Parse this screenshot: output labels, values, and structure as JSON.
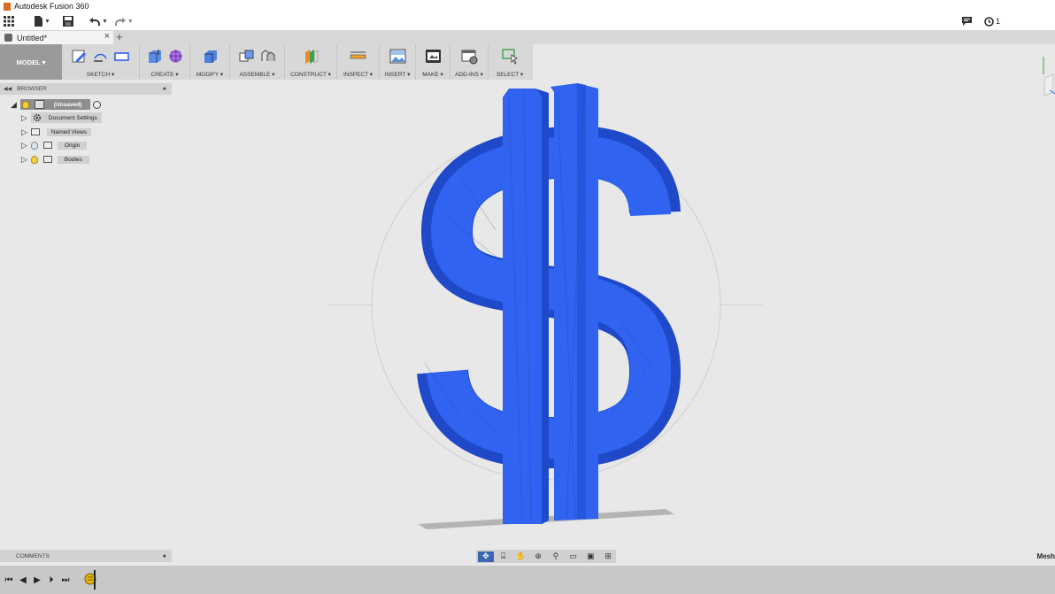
{
  "window": {
    "title": "Autodesk Fusion 360"
  },
  "quick_access": {
    "apps_icon": "grid-icon",
    "file_icon": "file-icon",
    "save_icon": "save-icon",
    "undo_icon": "undo-icon",
    "redo_icon": "redo-icon"
  },
  "status_area": {
    "comments_icon": "comment-icon",
    "job_status_count": "1"
  },
  "document_tab": {
    "label": "Untitled*",
    "close": "×",
    "new_tab": "+"
  },
  "toolbar": {
    "workspace": "MODEL ▾",
    "groups": [
      {
        "label": "SKETCH ▾"
      },
      {
        "label": "CREATE ▾"
      },
      {
        "label": "MODIFY ▾"
      },
      {
        "label": "ASSEMBLE ▾"
      },
      {
        "label": "CONSTRUCT ▾"
      },
      {
        "label": "INSPECT ▾"
      },
      {
        "label": "INSERT ▾"
      },
      {
        "label": "MAKE ▾"
      },
      {
        "label": "ADD-INS ▾"
      },
      {
        "label": "SELECT ▾"
      }
    ]
  },
  "browser": {
    "title": "BROWSER",
    "items": [
      {
        "label": "(Unsaved)"
      },
      {
        "label": "Document Settings"
      },
      {
        "label": "Named Views"
      },
      {
        "label": "Origin"
      },
      {
        "label": "Bodies"
      }
    ]
  },
  "comments": {
    "title": "COMMENTS"
  },
  "status": {
    "mesh_label": "Mesh"
  },
  "colors": {
    "model": "#2f63f0",
    "model_shade": "#1f49c9",
    "ground_shadow": "#b4b4b4"
  }
}
